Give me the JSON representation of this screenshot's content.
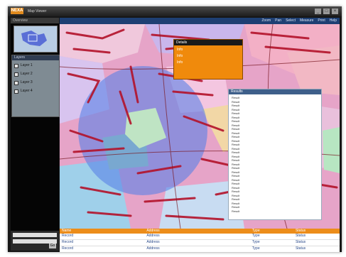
{
  "window": {
    "app_name": "NEXA",
    "title": "Map Viewer",
    "controls": [
      "_",
      "□",
      "×"
    ]
  },
  "sidebar": {
    "header": "Overview",
    "layers_title": "Layers",
    "layers": [
      "Layer 1",
      "Layer 2",
      "Layer 3",
      "Layer 4"
    ],
    "search_button": "Go"
  },
  "toolbar": {
    "items": [
      "Zoom",
      "Pan",
      "Select",
      "Measure",
      "Print",
      "Help"
    ]
  },
  "popup": {
    "title": "Details",
    "lines": [
      "Info",
      "Info",
      "Info"
    ]
  },
  "results_panel": {
    "title": "Results",
    "rows": [
      "Result",
      "Result",
      "Result",
      "Result",
      "Result",
      "Result",
      "Result",
      "Result",
      "Result",
      "Result",
      "Result",
      "Result",
      "Result",
      "Result",
      "Result",
      "Result",
      "Result",
      "Result",
      "Result",
      "Result",
      "Result",
      "Result",
      "Result",
      "Result",
      "Result",
      "Result",
      "Result",
      "Result",
      "Result",
      "Result"
    ]
  },
  "table": {
    "columns": [
      "Name",
      "Address",
      "Type",
      "Status"
    ],
    "rows": [
      [
        "Record",
        "Address",
        "Type",
        "Status"
      ],
      [
        "Record",
        "Address",
        "Type",
        "Status"
      ],
      [
        "Record",
        "Address",
        "Type",
        "Status"
      ]
    ]
  },
  "colors": {
    "accent": "#f08a0c",
    "toolbar": "#1e3f73",
    "map_buffer": "#5a82e6"
  }
}
